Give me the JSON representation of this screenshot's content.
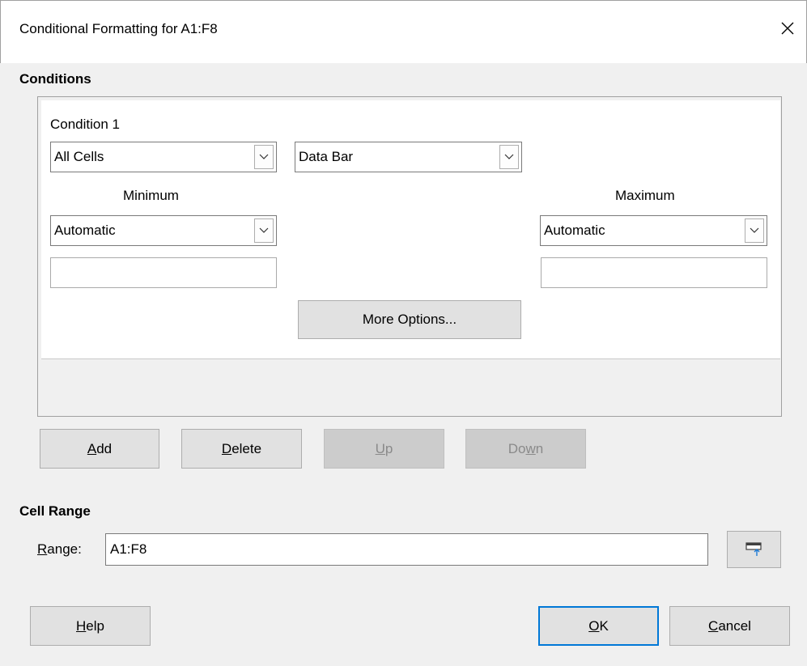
{
  "window": {
    "title": "Conditional Formatting for A1:F8"
  },
  "conditions": {
    "heading": "Conditions",
    "condition1": {
      "label": "Condition 1",
      "applies_to": "All Cells",
      "style_type": "Data Bar",
      "minimum_label": "Minimum",
      "minimum_type": "Automatic",
      "minimum_value": "",
      "maximum_label": "Maximum",
      "maximum_type": "Automatic",
      "maximum_value": "",
      "more_options": "More Options..."
    }
  },
  "list_buttons": {
    "add": {
      "mnemonic": "A",
      "rest": "dd"
    },
    "delete": {
      "mnemonic": "D",
      "rest": "elete"
    },
    "up": {
      "mnemonic": "U",
      "rest": "p"
    },
    "down": {
      "before": "Do",
      "mnemonic": "w",
      "rest": "n"
    }
  },
  "cell_range": {
    "heading": "Cell Range",
    "range_label": {
      "mnemonic": "R",
      "rest": "ange:"
    },
    "range_value": "A1:F8"
  },
  "footer": {
    "help": {
      "mnemonic": "H",
      "rest": "elp"
    },
    "ok": {
      "mnemonic": "O",
      "rest": "K"
    },
    "cancel": {
      "mnemonic": "C",
      "rest": "ancel"
    }
  },
  "icons": {
    "close": "close-icon",
    "dropdown": "chevron-down-icon",
    "shrink": "shrink-dialog-icon"
  },
  "colors": {
    "default_button_border": "#0078d7",
    "disabled_text": "#8a8a8a"
  }
}
